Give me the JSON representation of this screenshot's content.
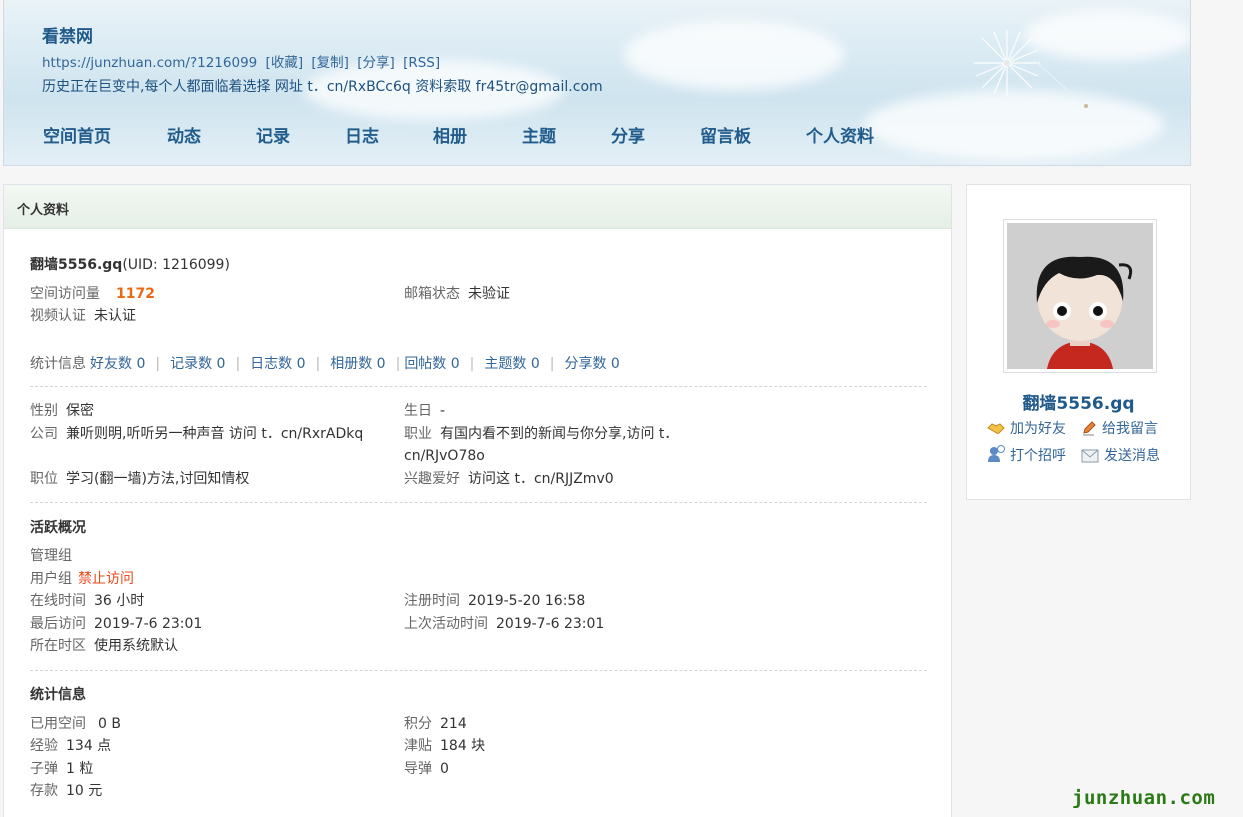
{
  "header": {
    "site_title": "看禁网",
    "url": "https://junzhuan.com/?1216099",
    "links": [
      "[收藏]",
      "[复制]",
      "[分享]",
      "[RSS]"
    ],
    "description": "历史正在巨变中,每个人都面临着选择 网址 t．cn/RxBCc6q 资料索取 fr45tr@gmail.com"
  },
  "nav": [
    "空间首页",
    "动态",
    "记录",
    "日志",
    "相册",
    "主题",
    "分享",
    "留言板",
    "个人资料"
  ],
  "panel": {
    "title": "个人资料",
    "username": "翻墙5556.gq",
    "uid": "(UID: 1216099)",
    "visits_label": "空间访问量",
    "visits": "1172",
    "email_label": "邮箱状态",
    "email": "未验证",
    "video_label": "视频认证",
    "video": "未认证",
    "stats_label": "统计信息",
    "stats": [
      "好友数 0",
      "记录数 0",
      "日志数 0",
      "相册数 0",
      "回帖数 0",
      "主题数 0",
      "分享数 0"
    ],
    "gender_label": "性别",
    "gender": "保密",
    "birthday_label": "生日",
    "birthday": "-",
    "company_label": "公司",
    "company": "兼听则明,听听另一种声音 访问 t．cn/RxrADkq",
    "job_label": "职业",
    "job_line1": "有国内看不到的新闻与你分享,访问 t．",
    "job_line2": "cn/RJvO78o",
    "position_label": "职位",
    "position": "学习(翻一墙)方法,讨回知情权",
    "hobby_label": "兴趣爱好",
    "hobby": "访问这 t．cn/RJJZmv0",
    "activity_title": "活跃概况",
    "admin_group_label": "管理组",
    "user_group_label": "用户组",
    "user_group": "禁止访问",
    "online_label": "在线时间",
    "online": "36 小时",
    "reg_label": "注册时间",
    "reg": "2019-5-20 16:58",
    "last_visit_label": "最后访问",
    "last_visit": "2019-7-6 23:01",
    "last_active_label": "上次活动时间",
    "last_active": "2019-7-6 23:01",
    "timezone_label": "所在时区",
    "timezone": "使用系统默认",
    "stat_title": "统计信息",
    "space_label": "已用空间",
    "space": "0 B",
    "points_label": "积分",
    "points": "214",
    "exp_label": "经验",
    "exp": "134 点",
    "subsidy_label": "津贴",
    "subsidy": "184 块",
    "bullet_label": "子弹",
    "bullet": "1 粒",
    "missile_label": "导弹",
    "missile": "0",
    "deposit_label": "存款",
    "deposit": "10 元"
  },
  "sidebar": {
    "name": "翻墙5556.gq",
    "add_friend": "加为好友",
    "leave_msg": "给我留言",
    "greet": "打个招呼",
    "send_msg": "发送消息"
  },
  "watermark": "junzhuan.com"
}
